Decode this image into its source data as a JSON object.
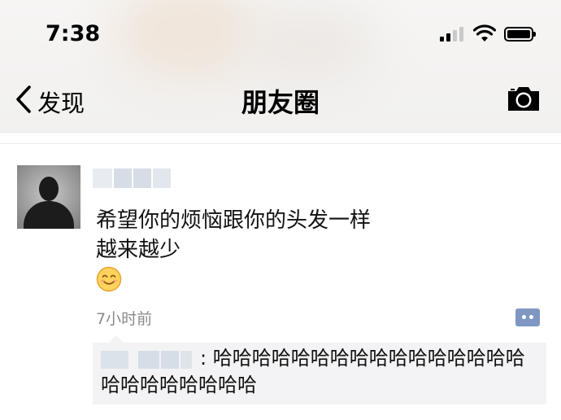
{
  "status_bar": {
    "time": "7:38"
  },
  "nav": {
    "back_label": "发现",
    "title": "朋友圈"
  },
  "post": {
    "text_line1": "希望你的烦恼跟你的头发一样",
    "text_line2": "越来越少",
    "emoji": "smiling-face",
    "timestamp": "7小时前"
  },
  "comment": {
    "separator": ":",
    "text": "哈哈哈哈哈哈哈哈哈哈哈哈哈哈哈哈哈哈哈哈哈哈哈哈"
  },
  "icons": {
    "back": "chevron-left-icon",
    "camera": "camera-icon",
    "wifi": "wifi-icon",
    "battery": "battery-icon",
    "signal": "signal-icon",
    "comment": "comment-icon"
  },
  "colors": {
    "link_blue": "#576b95",
    "comment_bg": "#f3f3f5",
    "timestamp": "#8a8a8a"
  }
}
